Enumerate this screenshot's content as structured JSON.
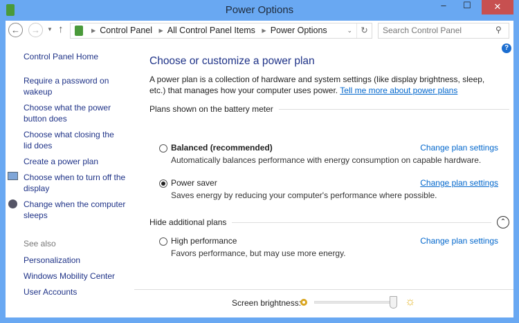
{
  "window": {
    "title": "Power Options",
    "minimize": "–",
    "maximize": "☐",
    "close": "✕"
  },
  "nav": {
    "back": "←",
    "forward": "→",
    "up": "↑",
    "breadcrumb": [
      "Control Panel",
      "All Control Panel Items",
      "Power Options"
    ],
    "search_placeholder": "Search Control Panel",
    "refresh": "↻"
  },
  "sidebar": {
    "home": "Control Panel Home",
    "items": [
      "Require a password on wakeup",
      "Choose what the power button does",
      "Choose what closing the lid does",
      "Create a power plan",
      "Choose when to turn off the display",
      "Change when the computer sleeps"
    ],
    "see_also_label": "See also",
    "see_also": [
      "Personalization",
      "Windows Mobility Center",
      "User Accounts"
    ]
  },
  "main": {
    "heading": "Choose or customize a power plan",
    "intro": "A power plan is a collection of hardware and system settings (like display brightness, sleep, etc.) that manages how your computer uses power. ",
    "intro_link": "Tell me more about power plans",
    "section1": "Plans shown on the battery meter",
    "section2": "Hide additional plans",
    "change": "Change plan settings",
    "plans": [
      {
        "name": "Balanced (recommended)",
        "desc": "Automatically balances performance with energy consumption on capable hardware.",
        "selected": false
      },
      {
        "name": "Power saver",
        "desc": "Saves energy by reducing your computer's performance where possible.",
        "selected": true
      },
      {
        "name": "High performance",
        "desc": "Favors performance, but may use more energy.",
        "selected": false
      }
    ]
  },
  "brightness": {
    "label": "Screen brightness:",
    "value_percent": 97
  },
  "colors": {
    "accent": "#69a8f2",
    "link": "#0066cc",
    "close": "#c75050"
  }
}
